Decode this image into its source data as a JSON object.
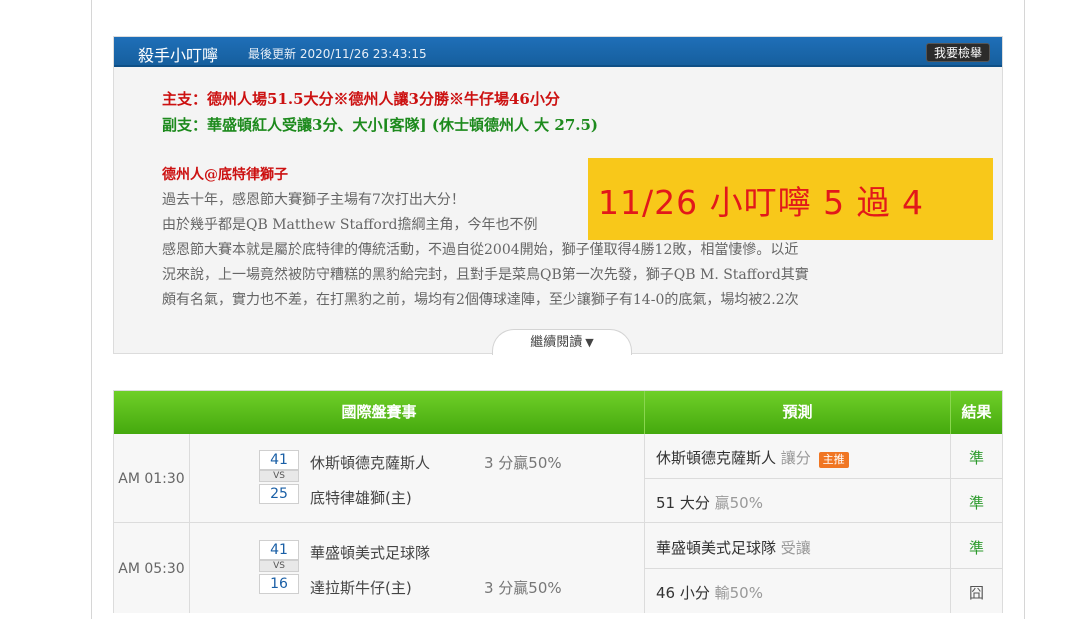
{
  "article": {
    "author": "殺手小叮嚀",
    "updated": "最後更新 2020/11/26 23:43:15",
    "report_button": "我要檢舉",
    "pick_main": "主支：德州人場51.5大分※德州人讓3分勝※牛仔場46小分",
    "pick_sub": "副支：華盛頓紅人受讓3分、大小[客隊] (休士頓德州人 大 27.5)",
    "game_title": "德州人@底特律獅子",
    "paragraphs": [
      "過去十年，感恩節大賽獅子主場有7次打出大分！",
      "由於幾乎都是QB Matthew Stafford擔綱主角，今年也不例",
      "感恩節大賽本就是屬於底特律的傳統活動，不過自從2004開始，獅子僅取得4勝12敗，相當悽慘。以近",
      "況來說，上一場竟然被防守糟糕的黑豹給完封，且對手是菜鳥QB第一次先發，獅子QB M. Stafford其實",
      "頗有名氣，實力也不差，在打黑豹之前，場均有2個傳球達陣，至少讓獅子有14-0的底氣，場均被2.2次"
    ],
    "read_more": "繼續閱讀",
    "overlay_text": "11/26 小叮嚀 5 過 4"
  },
  "table": {
    "headers": {
      "match": "國際盤賽事",
      "prediction": "預測",
      "result": "結果"
    },
    "games": [
      {
        "time": "AM 01:30",
        "home_score": "41",
        "home_team": "休斯頓德克薩斯人",
        "home_spread": "3 分贏50%",
        "vs": "VS",
        "away_score": "25",
        "away_team": "底特律雄獅(主)",
        "away_spread": "",
        "pred1_main": "休斯頓德克薩斯人",
        "pred1_muted": "讓分",
        "pred1_badge": "主推",
        "pred2_main": "51 大分",
        "pred2_muted": "贏50%",
        "result1": "準",
        "result2": "準"
      },
      {
        "time": "AM 05:30",
        "home_score": "41",
        "home_team": "華盛頓美式足球隊",
        "home_spread": "",
        "vs": "VS",
        "away_score": "16",
        "away_team": "達拉斯牛仔(主)",
        "away_spread": "3 分贏50%",
        "pred1_main": "華盛頓美式足球隊",
        "pred1_muted": "受讓",
        "pred1_badge": "",
        "pred2_main": "46 小分",
        "pred2_muted": "輸50%",
        "result1": "準",
        "result2": "囧"
      }
    ]
  },
  "colors": {
    "header_blue": "#1f6fb8",
    "table_green": "#45a90e",
    "pick_red": "#cc1111",
    "pick_green": "#1d8a1d",
    "overlay_yellow": "#f8c81a",
    "badge_orange": "#f07623"
  }
}
